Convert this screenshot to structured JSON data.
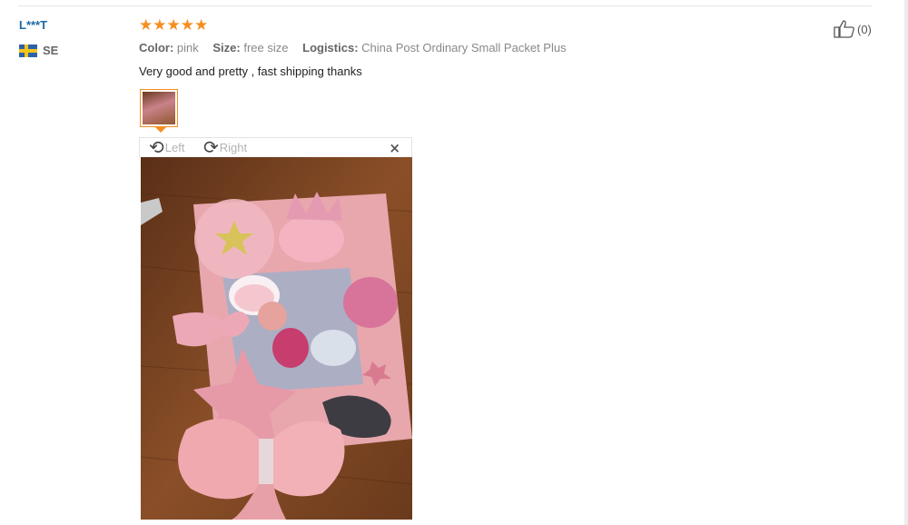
{
  "review": {
    "user": "L***T",
    "country_code": "SE",
    "rating": 5,
    "props": {
      "color_label": "Color:",
      "color_value": "pink",
      "size_label": "Size:",
      "size_value": "free size",
      "logistics_label": "Logistics:",
      "logistics_value": "China Post Ordinary Small Packet Plus"
    },
    "text": "Very good and pretty , fast shipping thanks",
    "helpful_count": "(0)"
  },
  "viewer": {
    "rotate_left_label": "Left",
    "rotate_right_label": "Right",
    "close_glyph": "×"
  },
  "icons": {
    "flag": "sweden-flag-icon",
    "star": "star-icon",
    "thumbs_up": "thumbs-up-icon",
    "rotate_left": "rotate-left-icon",
    "rotate_right": "rotate-right-icon",
    "close": "close-icon"
  },
  "colors": {
    "accent": "#f68e1f",
    "username": "#1b6aa8"
  }
}
